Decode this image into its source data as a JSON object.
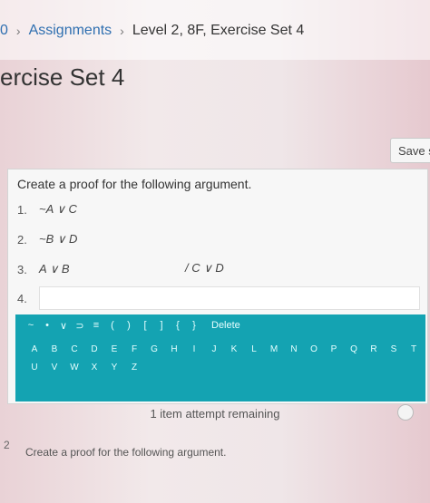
{
  "breadcrumb": {
    "prefix": "0",
    "assignments": "Assignments",
    "current": "Level 2, 8F, Exercise Set 4"
  },
  "page_title": "ercise Set 4",
  "save_label": "Save s",
  "question": {
    "prompt": "Create a proof for the following argument.",
    "lines": [
      {
        "num": "1.",
        "expr": "~A ∨ C"
      },
      {
        "num": "2.",
        "expr": "~B ∨ D"
      },
      {
        "num": "3.",
        "expr": "A ∨ B"
      }
    ],
    "conclusion": "/ C ∨ D",
    "input_num": "4."
  },
  "keypad": {
    "symbols": [
      "~",
      "•",
      "∨",
      "⊃",
      "≡",
      "(",
      ")",
      "[",
      "]",
      "{",
      "}"
    ],
    "delete_label": "Delete",
    "letters_row1": [
      "A",
      "B",
      "C",
      "D",
      "E",
      "F",
      "G",
      "H",
      "I",
      "J",
      "K",
      "L",
      "M",
      "N",
      "O",
      "P",
      "Q",
      "R",
      "S",
      "T"
    ],
    "letters_row2": [
      "U",
      "V",
      "W",
      "X",
      "Y",
      "Z"
    ]
  },
  "attempts_text": "1 item attempt remaining",
  "next_question": {
    "num": "2",
    "prompt": "Create a proof for the following argument."
  }
}
